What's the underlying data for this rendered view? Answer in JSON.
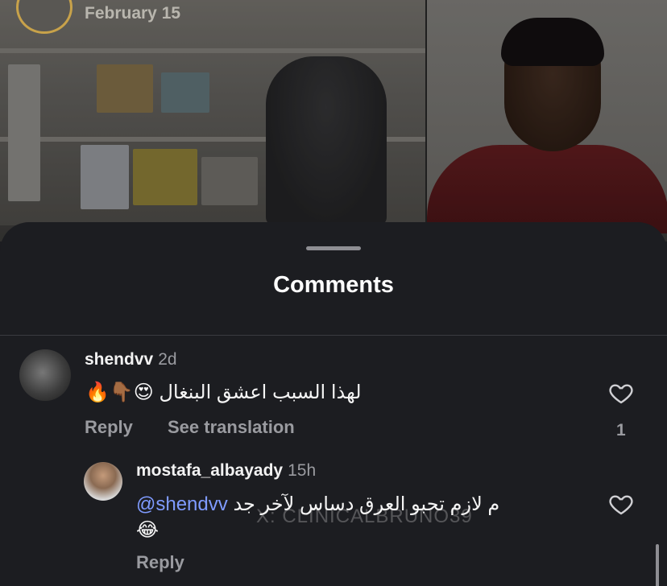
{
  "post": {
    "date": "February 15"
  },
  "sheet": {
    "title": "Comments"
  },
  "comments": [
    {
      "username": "shendvv",
      "time": "2d",
      "text": "لهذا السبب اعشق البنغال 😍👇🏾🔥",
      "reply_label": "Reply",
      "translate_label": "See translation",
      "like_count": "1"
    }
  ],
  "replies": [
    {
      "username": "mostafa_albayady",
      "time": "15h",
      "mention": "@shendvv",
      "text": "م لازم تحبو العرق دساس لآخر جد",
      "emoji": "😂",
      "reply_label": "Reply"
    }
  ],
  "watermark": "X: CLINICALBRUNO39",
  "icons": {
    "like": "heart-outline-icon"
  },
  "colors": {
    "sheet_background": "#1c1d21",
    "mention": "#7f9bff",
    "secondary_text": "#9a9ba0"
  }
}
